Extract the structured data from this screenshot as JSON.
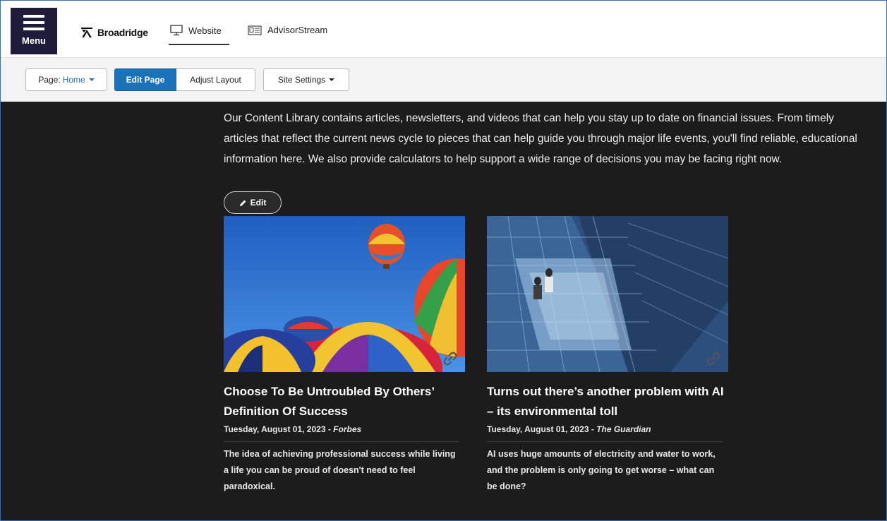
{
  "header": {
    "menu_label": "Menu",
    "brand_name": "Broadridge",
    "nav": [
      {
        "label": "Website",
        "icon": "monitor-icon",
        "active": true
      },
      {
        "label": "AdvisorStream",
        "icon": "newspaper-icon",
        "active": false
      }
    ]
  },
  "toolbar": {
    "page_prefix": "Page:",
    "page_value": "Home",
    "edit_page_label": "Edit Page",
    "adjust_layout_label": "Adjust Layout",
    "site_settings_label": "Site Settings",
    "accent_color": "#1a73b8"
  },
  "content": {
    "intro": "Our Content Library contains articles, newsletters, and videos that can help you stay up to date on financial issues. From timely articles that reflect the current news cycle to pieces that can help guide you through major life events, you'll find reliable, educational information here. We also provide calculators to help support a wide range of decisions you may be facing right now.",
    "edit_label": "Edit",
    "cards": [
      {
        "title": "Choose To Be Untroubled By Others’ Definition Of Success",
        "date": "Tuesday, August 01, 2023",
        "separator": " - ",
        "source": "Forbes",
        "description": "The idea of achieving professional success while living a life you can be proud of doesn't need to feel paradoxical.",
        "image": "hot-air-balloons-image"
      },
      {
        "title": "Turns out there’s another problem with AI – its environmental toll",
        "date": "Tuesday, August 01, 2023",
        "separator": " - ",
        "source": "The Guardian",
        "description": "AI uses huge amounts of electricity and water to work, and the problem is only going to get worse – what can be done?",
        "image": "data-center-image"
      }
    ]
  }
}
